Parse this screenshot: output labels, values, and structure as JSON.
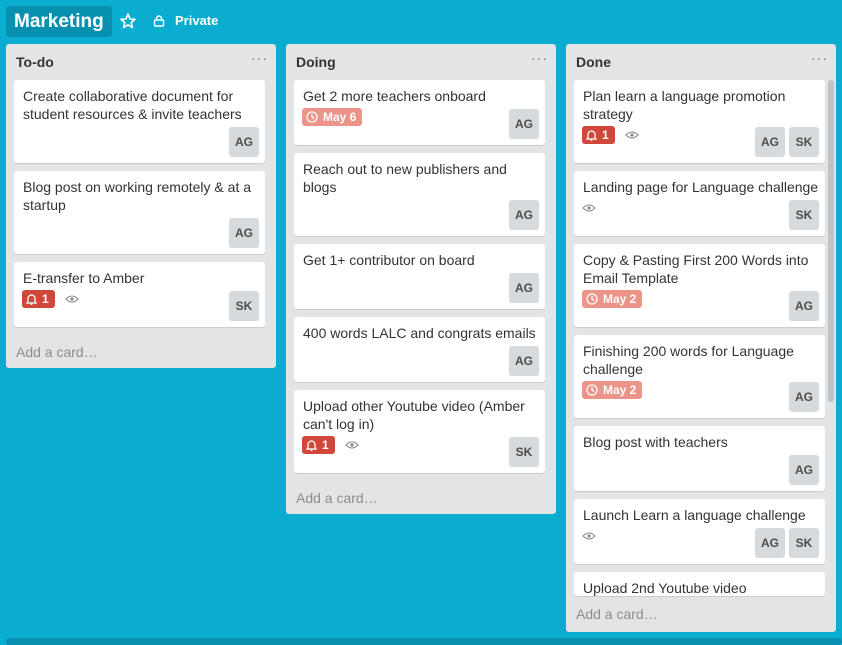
{
  "board": {
    "title": "Marketing",
    "star_icon": "star-icon",
    "visibility": "Private",
    "visibility_icon": "lock-icon"
  },
  "colors": {
    "background": "#0aaccf",
    "list": "#e2e4e6",
    "due_badge": "#ec9488",
    "notification_badge": "#d0483a"
  },
  "lists": [
    {
      "title": "To-do",
      "menu": "···",
      "add_card": "Add a card…",
      "cards": [
        {
          "title": [
            "Create collaborative document for",
            "student resources & invite teachers"
          ],
          "members": [
            "AG"
          ]
        },
        {
          "title": [
            "Blog post on working remotely & at a",
            "startup"
          ],
          "members": [
            "AG"
          ]
        },
        {
          "title": [
            "E-transfer to Amber"
          ],
          "notifications": "1",
          "watching": true,
          "members": [
            "SK"
          ]
        }
      ]
    },
    {
      "title": "Doing",
      "menu": "···",
      "add_card": "Add a card…",
      "cards": [
        {
          "title": [
            "Get 2 more teachers onboard"
          ],
          "due": "May 6",
          "members": [
            "AG"
          ]
        },
        {
          "title": [
            "Reach out to new publishers and",
            "blogs"
          ],
          "members": [
            "AG"
          ]
        },
        {
          "title": [
            "Get 1+ contributor on board"
          ],
          "members": [
            "AG"
          ]
        },
        {
          "title": [
            "400 words LALC and congrats emails"
          ],
          "members": [
            "AG"
          ]
        },
        {
          "title": [
            "Upload other Youtube video (Amber",
            "can't log in)"
          ],
          "notifications": "1",
          "watching": true,
          "members": [
            "SK"
          ]
        }
      ]
    },
    {
      "title": "Done",
      "menu": "···",
      "add_card": "Add a card…",
      "cards": [
        {
          "title": [
            "Plan learn a language promotion",
            "strategy"
          ],
          "notifications": "1",
          "watching": true,
          "members": [
            "AG",
            "SK"
          ]
        },
        {
          "title": [
            "Landing page for Language challenge"
          ],
          "watching": true,
          "members": [
            "SK"
          ]
        },
        {
          "title": [
            "Copy & Pasting First 200 Words into",
            "Email Template"
          ],
          "due": "May 2",
          "members": [
            "AG"
          ]
        },
        {
          "title": [
            "Finishing 200 words for Language",
            "challenge"
          ],
          "due": "May 2",
          "members": [
            "AG"
          ]
        },
        {
          "title": [
            "Blog post with teachers"
          ],
          "members": [
            "AG"
          ]
        },
        {
          "title": [
            "Launch Learn a language challenge"
          ],
          "watching": true,
          "members": [
            "AG",
            "SK"
          ]
        },
        {
          "title": [
            "Upload 2nd Youtube video"
          ],
          "members": []
        }
      ]
    }
  ]
}
